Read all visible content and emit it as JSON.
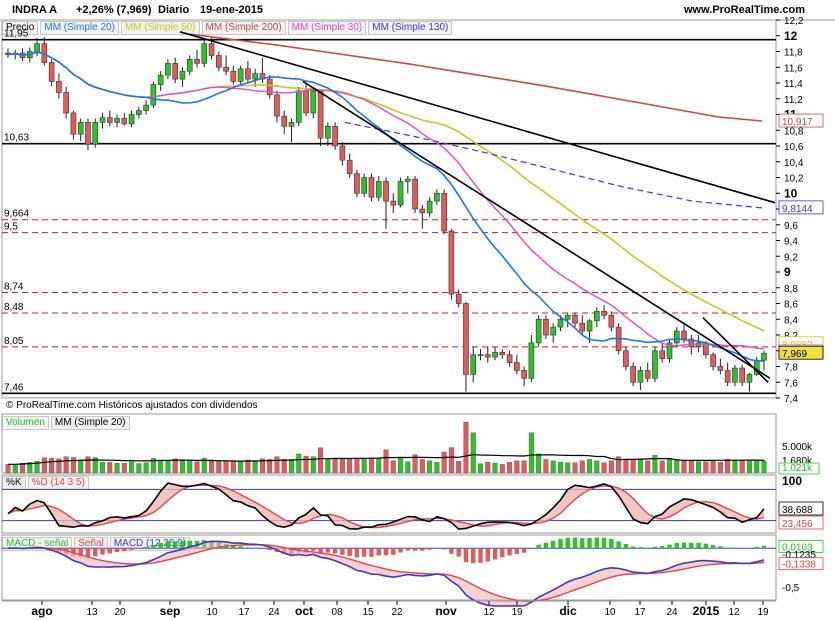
{
  "header": {
    "title": "INDRA A",
    "change": "+2,26% (7,969)",
    "period": "Diario",
    "date": "19-ene-2015",
    "site": "www.ProRealTime.com"
  },
  "colors": {
    "bull": "#28c428",
    "bear": "#e25a5a",
    "ma20": "#1e78dc",
    "ma50": "#c8c81e",
    "ma200": "#c84b4b",
    "ma30": "#e648c8",
    "ma130": "#3a3ac8",
    "volume_ma": "#000000",
    "stoch_k": "#000000",
    "stoch_d": "#e04646",
    "macd": "#3a3ac8",
    "macd_signal": "#e04646",
    "macd_hist": "#28c428"
  },
  "price_panel": {
    "legend": [
      "Precio",
      "MM (Simple 20)",
      "MM (Simple 50)",
      "MM (Simple 200)",
      "MM (Simple 30)",
      "MM (Simple 130)"
    ],
    "footer": "© ProRealTime.com  Históricos ajustados con dividendos",
    "level_labels": [
      "11,95",
      "10,63",
      "9,664",
      "9,5",
      "8,74",
      "8,48",
      "8,05",
      "7,46"
    ],
    "axis_labels": [
      "12,2",
      "12",
      "11,8",
      "11,6",
      "11,4",
      "11,2",
      "11",
      "10,8",
      "10,6",
      "10,4",
      "10,2",
      "10",
      "9,8",
      "9,6",
      "9,4",
      "9,2",
      "9",
      "8,8",
      "8,6",
      "8,4",
      "8,2",
      "8",
      "7,8",
      "7,6",
      "7,4"
    ],
    "right_tags": [
      "10,917",
      "9,8144",
      "8,0882",
      "7,9848",
      "7,969"
    ]
  },
  "volume_panel": {
    "legend": [
      "Volumen",
      "MM (Simple 20)"
    ],
    "axis_labels": [
      "5.000k",
      "1.680k",
      "1.021k"
    ]
  },
  "stoch_panel": {
    "legend": [
      "%K",
      "%D (14 3 5)"
    ],
    "axis_labels": [
      "100",
      "38,688",
      "23,456"
    ]
  },
  "macd_panel": {
    "legend": [
      "MACD - señal",
      "Señal",
      "MACD (12 26 9)"
    ],
    "axis_labels": [
      "0,0103",
      "-0,1235",
      "-0,1338",
      "-0,5"
    ]
  },
  "x_axis": {
    "labels": [
      "ago",
      "13",
      "20",
      "sep",
      "10",
      "17",
      "24",
      "oct",
      "08",
      "15",
      "22",
      "nov",
      "12",
      "19",
      "dic",
      "10",
      "17",
      "24",
      "2015",
      "12",
      "19"
    ]
  },
  "chart_data": {
    "type": "candlestick",
    "title": "INDRA A",
    "ylim": [
      7.4,
      12.2
    ],
    "horizontal_levels": [
      11.95,
      10.63,
      9.664,
      9.5,
      8.74,
      8.48,
      8.05,
      7.46
    ],
    "ohlc": [
      {
        "o": 11.78,
        "h": 11.84,
        "l": 11.72,
        "c": 11.76
      },
      {
        "o": 11.76,
        "h": 11.82,
        "l": 11.7,
        "c": 11.78
      },
      {
        "o": 11.78,
        "h": 11.84,
        "l": 11.68,
        "c": 11.72
      },
      {
        "o": 11.72,
        "h": 11.85,
        "l": 11.66,
        "c": 11.8
      },
      {
        "o": 11.8,
        "h": 11.97,
        "l": 11.74,
        "c": 11.9
      },
      {
        "o": 11.9,
        "h": 11.98,
        "l": 11.62,
        "c": 11.66
      },
      {
        "o": 11.66,
        "h": 11.7,
        "l": 11.36,
        "c": 11.42
      },
      {
        "o": 11.42,
        "h": 11.52,
        "l": 11.2,
        "c": 11.28
      },
      {
        "o": 11.28,
        "h": 11.35,
        "l": 10.95,
        "c": 11.02
      },
      {
        "o": 11.02,
        "h": 11.05,
        "l": 10.68,
        "c": 10.75
      },
      {
        "o": 10.75,
        "h": 10.95,
        "l": 10.66,
        "c": 10.9
      },
      {
        "o": 10.9,
        "h": 10.95,
        "l": 10.55,
        "c": 10.62
      },
      {
        "o": 10.62,
        "h": 10.95,
        "l": 10.58,
        "c": 10.9
      },
      {
        "o": 10.9,
        "h": 11.02,
        "l": 10.82,
        "c": 10.96
      },
      {
        "o": 10.96,
        "h": 11.05,
        "l": 10.85,
        "c": 10.9
      },
      {
        "o": 10.9,
        "h": 11.0,
        "l": 10.84,
        "c": 10.95
      },
      {
        "o": 10.95,
        "h": 11.02,
        "l": 10.86,
        "c": 10.88
      },
      {
        "o": 10.88,
        "h": 11.05,
        "l": 10.84,
        "c": 11.0
      },
      {
        "o": 11.0,
        "h": 11.1,
        "l": 10.95,
        "c": 11.05
      },
      {
        "o": 11.05,
        "h": 11.18,
        "l": 11.0,
        "c": 11.12
      },
      {
        "o": 11.12,
        "h": 11.42,
        "l": 11.08,
        "c": 11.38
      },
      {
        "o": 11.38,
        "h": 11.55,
        "l": 11.3,
        "c": 11.5
      },
      {
        "o": 11.5,
        "h": 11.7,
        "l": 11.45,
        "c": 11.65
      },
      {
        "o": 11.65,
        "h": 11.72,
        "l": 11.4,
        "c": 11.45
      },
      {
        "o": 11.45,
        "h": 11.6,
        "l": 11.35,
        "c": 11.55
      },
      {
        "o": 11.55,
        "h": 11.75,
        "l": 11.5,
        "c": 11.7
      },
      {
        "o": 11.7,
        "h": 11.82,
        "l": 11.6,
        "c": 11.65
      },
      {
        "o": 11.65,
        "h": 11.95,
        "l": 11.6,
        "c": 11.9
      },
      {
        "o": 11.9,
        "h": 11.98,
        "l": 11.7,
        "c": 11.75
      },
      {
        "o": 11.75,
        "h": 11.8,
        "l": 11.55,
        "c": 11.6
      },
      {
        "o": 11.6,
        "h": 11.75,
        "l": 11.5,
        "c": 11.55
      },
      {
        "o": 11.55,
        "h": 11.62,
        "l": 11.38,
        "c": 11.42
      },
      {
        "o": 11.42,
        "h": 11.62,
        "l": 11.38,
        "c": 11.58
      },
      {
        "o": 11.58,
        "h": 11.68,
        "l": 11.4,
        "c": 11.45
      },
      {
        "o": 11.45,
        "h": 11.58,
        "l": 11.35,
        "c": 11.52
      },
      {
        "o": 11.52,
        "h": 11.72,
        "l": 11.4,
        "c": 11.45
      },
      {
        "o": 11.45,
        "h": 11.5,
        "l": 11.2,
        "c": 11.25
      },
      {
        "o": 11.25,
        "h": 11.3,
        "l": 10.9,
        "c": 10.98
      },
      {
        "o": 10.98,
        "h": 11.05,
        "l": 10.75,
        "c": 10.85
      },
      {
        "o": 10.85,
        "h": 10.95,
        "l": 10.65,
        "c": 10.9
      },
      {
        "o": 10.9,
        "h": 11.35,
        "l": 10.85,
        "c": 11.3
      },
      {
        "o": 11.3,
        "h": 11.4,
        "l": 10.98,
        "c": 11.02
      },
      {
        "o": 11.02,
        "h": 11.35,
        "l": 10.95,
        "c": 11.3
      },
      {
        "o": 11.3,
        "h": 11.32,
        "l": 10.6,
        "c": 10.7
      },
      {
        "o": 10.7,
        "h": 10.9,
        "l": 10.6,
        "c": 10.85
      },
      {
        "o": 10.85,
        "h": 10.9,
        "l": 10.55,
        "c": 10.6
      },
      {
        "o": 10.6,
        "h": 10.65,
        "l": 10.35,
        "c": 10.42
      },
      {
        "o": 10.42,
        "h": 10.5,
        "l": 10.2,
        "c": 10.25
      },
      {
        "o": 10.25,
        "h": 10.3,
        "l": 9.95,
        "c": 10.0
      },
      {
        "o": 10.0,
        "h": 10.25,
        "l": 9.95,
        "c": 10.2
      },
      {
        "o": 10.2,
        "h": 10.25,
        "l": 9.9,
        "c": 9.95
      },
      {
        "o": 9.95,
        "h": 10.22,
        "l": 9.9,
        "c": 10.15
      },
      {
        "o": 10.15,
        "h": 10.2,
        "l": 9.55,
        "c": 9.9
      },
      {
        "o": 9.9,
        "h": 10.0,
        "l": 9.75,
        "c": 9.85
      },
      {
        "o": 9.85,
        "h": 10.2,
        "l": 9.82,
        "c": 10.15
      },
      {
        "o": 10.15,
        "h": 10.22,
        "l": 10.0,
        "c": 10.18
      },
      {
        "o": 10.18,
        "h": 10.22,
        "l": 9.75,
        "c": 9.8
      },
      {
        "o": 9.8,
        "h": 9.85,
        "l": 9.55,
        "c": 9.75
      },
      {
        "o": 9.75,
        "h": 9.95,
        "l": 9.7,
        "c": 9.9
      },
      {
        "o": 9.9,
        "h": 10.05,
        "l": 9.85,
        "c": 10.0
      },
      {
        "o": 10.0,
        "h": 10.05,
        "l": 9.48,
        "c": 9.52
      },
      {
        "o": 9.52,
        "h": 9.55,
        "l": 8.65,
        "c": 8.72
      },
      {
        "o": 8.72,
        "h": 8.78,
        "l": 8.55,
        "c": 8.6
      },
      {
        "o": 8.6,
        "h": 8.62,
        "l": 7.48,
        "c": 7.7
      },
      {
        "o": 7.7,
        "h": 8.05,
        "l": 7.6,
        "c": 7.95
      },
      {
        "o": 7.95,
        "h": 8.02,
        "l": 7.88,
        "c": 7.95
      },
      {
        "o": 7.95,
        "h": 8.05,
        "l": 7.85,
        "c": 7.92
      },
      {
        "o": 7.92,
        "h": 8.05,
        "l": 7.88,
        "c": 7.98
      },
      {
        "o": 7.98,
        "h": 8.02,
        "l": 7.9,
        "c": 7.95
      },
      {
        "o": 7.95,
        "h": 8.0,
        "l": 7.8,
        "c": 7.85
      },
      {
        "o": 7.85,
        "h": 7.95,
        "l": 7.7,
        "c": 7.75
      },
      {
        "o": 7.75,
        "h": 7.8,
        "l": 7.55,
        "c": 7.65
      },
      {
        "o": 7.65,
        "h": 8.2,
        "l": 7.6,
        "c": 8.1
      },
      {
        "o": 8.1,
        "h": 8.45,
        "l": 8.05,
        "c": 8.4
      },
      {
        "o": 8.4,
        "h": 8.45,
        "l": 8.15,
        "c": 8.2
      },
      {
        "o": 8.2,
        "h": 8.35,
        "l": 8.1,
        "c": 8.3
      },
      {
        "o": 8.3,
        "h": 8.45,
        "l": 8.25,
        "c": 8.4
      },
      {
        "o": 8.4,
        "h": 8.48,
        "l": 8.3,
        "c": 8.45
      },
      {
        "o": 8.45,
        "h": 8.48,
        "l": 8.3,
        "c": 8.35
      },
      {
        "o": 8.35,
        "h": 8.45,
        "l": 8.2,
        "c": 8.25
      },
      {
        "o": 8.25,
        "h": 8.4,
        "l": 8.1,
        "c": 8.38
      },
      {
        "o": 8.38,
        "h": 8.55,
        "l": 8.3,
        "c": 8.5
      },
      {
        "o": 8.5,
        "h": 8.58,
        "l": 8.4,
        "c": 8.45
      },
      {
        "o": 8.45,
        "h": 8.5,
        "l": 8.25,
        "c": 8.3
      },
      {
        "o": 8.3,
        "h": 8.35,
        "l": 7.95,
        "c": 8.0
      },
      {
        "o": 8.0,
        "h": 8.05,
        "l": 7.75,
        "c": 7.8
      },
      {
        "o": 7.8,
        "h": 7.85,
        "l": 7.55,
        "c": 7.6
      },
      {
        "o": 7.6,
        "h": 7.8,
        "l": 7.5,
        "c": 7.75
      },
      {
        "o": 7.75,
        "h": 7.85,
        "l": 7.6,
        "c": 7.65
      },
      {
        "o": 7.65,
        "h": 8.05,
        "l": 7.6,
        "c": 8.0
      },
      {
        "o": 8.0,
        "h": 8.1,
        "l": 7.85,
        "c": 7.9
      },
      {
        "o": 7.9,
        "h": 8.15,
        "l": 7.85,
        "c": 8.1
      },
      {
        "o": 8.1,
        "h": 8.3,
        "l": 8.05,
        "c": 8.25
      },
      {
        "o": 8.25,
        "h": 8.35,
        "l": 8.1,
        "c": 8.15
      },
      {
        "o": 8.15,
        "h": 8.2,
        "l": 7.95,
        "c": 8.05
      },
      {
        "o": 8.05,
        "h": 8.2,
        "l": 7.98,
        "c": 8.1
      },
      {
        "o": 8.1,
        "h": 8.12,
        "l": 7.9,
        "c": 7.95
      },
      {
        "o": 7.95,
        "h": 7.98,
        "l": 7.75,
        "c": 7.8
      },
      {
        "o": 7.8,
        "h": 7.9,
        "l": 7.7,
        "c": 7.75
      },
      {
        "o": 7.75,
        "h": 7.85,
        "l": 7.55,
        "c": 7.6
      },
      {
        "o": 7.6,
        "h": 7.82,
        "l": 7.55,
        "c": 7.78
      },
      {
        "o": 7.78,
        "h": 7.82,
        "l": 7.55,
        "c": 7.6
      },
      {
        "o": 7.6,
        "h": 7.72,
        "l": 7.48,
        "c": 7.7
      },
      {
        "o": 7.7,
        "h": 7.92,
        "l": 7.68,
        "c": 7.88
      },
      {
        "o": 7.88,
        "h": 8.0,
        "l": 7.75,
        "c": 7.969
      }
    ],
    "ma200": [
      12.02,
      11.95,
      11.88,
      11.8,
      11.72,
      11.64,
      11.55,
      11.46,
      11.37,
      11.27,
      11.17,
      11.07,
      10.97,
      10.917
    ],
    "ma130": [
      10.9,
      10.72,
      10.52,
      10.3,
      10.08,
      9.9,
      9.8144
    ]
  }
}
